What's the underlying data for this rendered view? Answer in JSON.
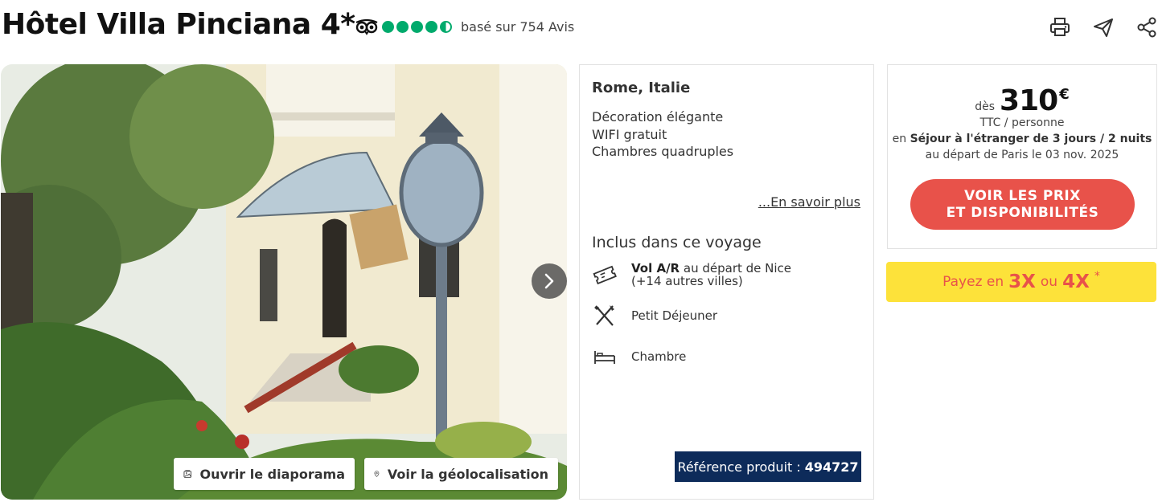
{
  "header": {
    "title": "Hôtel Villa Pinciana 4*",
    "reviews": "basé sur 754 Avis",
    "rating": 4.5
  },
  "icons": {
    "tripadvisor": "tripadvisor-owl-icon",
    "print": "printer-icon",
    "send": "send-icon",
    "share": "share-icon",
    "next": "chevron-right-icon",
    "slideshow": "gallery-icon",
    "geo": "map-pin-icon",
    "flight": "ticket-icon",
    "meal": "fork-knife-icon",
    "room": "bed-icon"
  },
  "photo": {
    "slideshow_label": "Ouvrir le diaporama",
    "geo_label": "Voir la géolocalisation"
  },
  "info": {
    "location": "Rome, Italie",
    "features": [
      "Décoration élégante",
      "WIFI gratuit",
      "Chambres quadruples"
    ],
    "more_link": "...En savoir plus",
    "included_title": "Inclus dans ce voyage",
    "flight_bold": "Vol A/R",
    "flight_rest": "au départ de Nice",
    "flight_line2": "(+14 autres villes)",
    "meal": "Petit Déjeuner",
    "room": "Chambre",
    "ref_label": "Référence produit :",
    "ref_value": "494727"
  },
  "price": {
    "from": "dès",
    "amount": "310",
    "currency": "€",
    "ttc": "TTC / personne",
    "stay_prefix": "en",
    "stay_bold": "Séjour à l'étranger de 3 jours / 2 nuits",
    "departure": "au départ de Paris le 03 nov. 2025",
    "cta_line1": "VOIR LES PRIX",
    "cta_line2": "ET DISPONIBILITÉS"
  },
  "payment": {
    "prefix": "Payez en",
    "option1": "3X",
    "connector": "ou",
    "option2": "4X",
    "star": "*"
  },
  "colors": {
    "tripadvisor_green": "#00aa6c",
    "cta_red": "#e8524a",
    "banner_yellow": "#fde23a",
    "ref_navy": "#0d2b5a"
  }
}
